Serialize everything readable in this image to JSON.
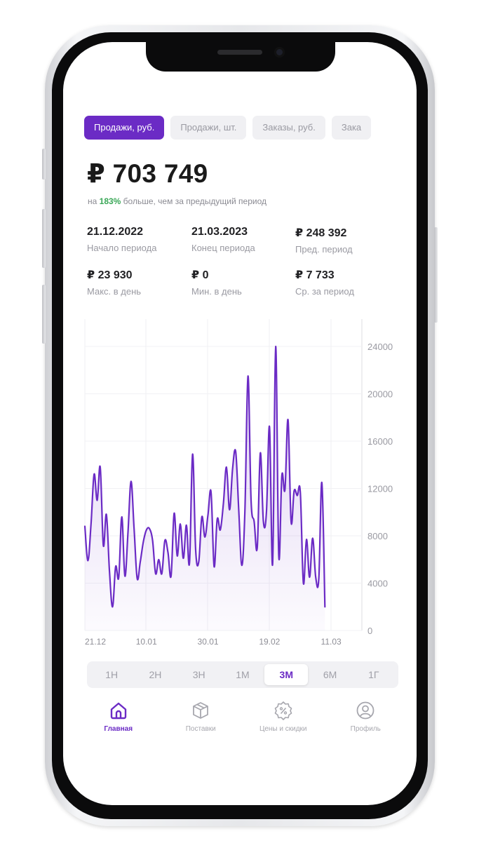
{
  "tabs": [
    {
      "label": "Продажи, руб.",
      "active": true
    },
    {
      "label": "Продажи, шт.",
      "active": false
    },
    {
      "label": "Заказы, руб.",
      "active": false
    },
    {
      "label": "Зака",
      "active": false
    }
  ],
  "summary": {
    "total": "₽ 703 749",
    "compare_prefix": "на ",
    "compare_pct": "183%",
    "compare_suffix": " больше, чем за предыдущий период"
  },
  "stats": [
    {
      "value": "21.12.2022",
      "label": "Начало периода"
    },
    {
      "value": "21.03.2023",
      "label": "Конец периода"
    },
    {
      "value": "₽  248 392",
      "label": "Пред. период"
    },
    {
      "value": "₽ 23 930",
      "label": "Макс. в день"
    },
    {
      "value": "₽ 0",
      "label": "Мин. в день"
    },
    {
      "value": "₽ 7 733",
      "label": "Ср. за период"
    }
  ],
  "chart_data": {
    "type": "area",
    "title": "",
    "xlabel": "",
    "ylabel": "",
    "ylim": [
      0,
      24000
    ],
    "y_ticks": [
      "24000",
      "20000",
      "16000",
      "12000",
      "8000",
      "4000",
      "0"
    ],
    "x_tick_labels": [
      "21.12",
      "10.01",
      "30.01",
      "19.02",
      "11.03"
    ],
    "x_tick_days": [
      0,
      20,
      40,
      60,
      80
    ],
    "grid": true,
    "series": [
      {
        "days": [
          0,
          1,
          2,
          3,
          4,
          5,
          6,
          7,
          8,
          9,
          10,
          11,
          12,
          13,
          14,
          15,
          16,
          17,
          18,
          19,
          20,
          21,
          22,
          23,
          24,
          25,
          26,
          27,
          28,
          29,
          30,
          31,
          32,
          33,
          34,
          35,
          36,
          37,
          38,
          39,
          40,
          41,
          42,
          43,
          44,
          45,
          46,
          47,
          48,
          49,
          50,
          51,
          52,
          53,
          54,
          55,
          56,
          57,
          58,
          59,
          60,
          61,
          62,
          63,
          64,
          65,
          66,
          67,
          68,
          69,
          70,
          71,
          72,
          73,
          74,
          75,
          76,
          77,
          78,
          79,
          80,
          81,
          82,
          83,
          84,
          85,
          86,
          87,
          88,
          89,
          90
        ],
        "values": [
          8800,
          5900,
          9000,
          13200,
          11000,
          13800,
          7200,
          9800,
          5000,
          2000,
          5400,
          4500,
          9600,
          4600,
          8200,
          12600,
          8600,
          4400,
          5800,
          7500,
          8500,
          8600,
          7600,
          4800,
          6000,
          4800,
          7600,
          6600,
          4600,
          9900,
          6300,
          9000,
          6100,
          8900,
          5700,
          14900,
          6800,
          5800,
          9600,
          7900,
          9800,
          11700,
          5400,
          9400,
          8500,
          10700,
          13800,
          10200,
          13700,
          15100,
          10200,
          5500,
          10100,
          21500,
          11000,
          9200,
          7000,
          15000,
          9200,
          10000,
          17200,
          5600,
          24000,
          6300,
          13100,
          11900,
          17800,
          9200,
          11800,
          11400,
          11700,
          4000,
          7700,
          4500,
          7800,
          4500,
          4400,
          12500,
          2000
        ]
      }
    ],
    "line_color": "#6b2bc5"
  },
  "periods": [
    {
      "label": "1Н",
      "active": false
    },
    {
      "label": "2Н",
      "active": false
    },
    {
      "label": "3Н",
      "active": false
    },
    {
      "label": "1М",
      "active": false
    },
    {
      "label": "3М",
      "active": true
    },
    {
      "label": "6М",
      "active": false
    },
    {
      "label": "1Г",
      "active": false
    }
  ],
  "nav": [
    {
      "label": "Главная",
      "icon": "home-icon",
      "active": true
    },
    {
      "label": "Поставки",
      "icon": "box-icon",
      "active": false
    },
    {
      "label": "Цены и скидки",
      "icon": "discount-icon",
      "active": false
    },
    {
      "label": "Профиль",
      "icon": "profile-icon",
      "active": false
    }
  ],
  "colors": {
    "accent": "#6b2bc5",
    "positive": "#3aa757"
  }
}
